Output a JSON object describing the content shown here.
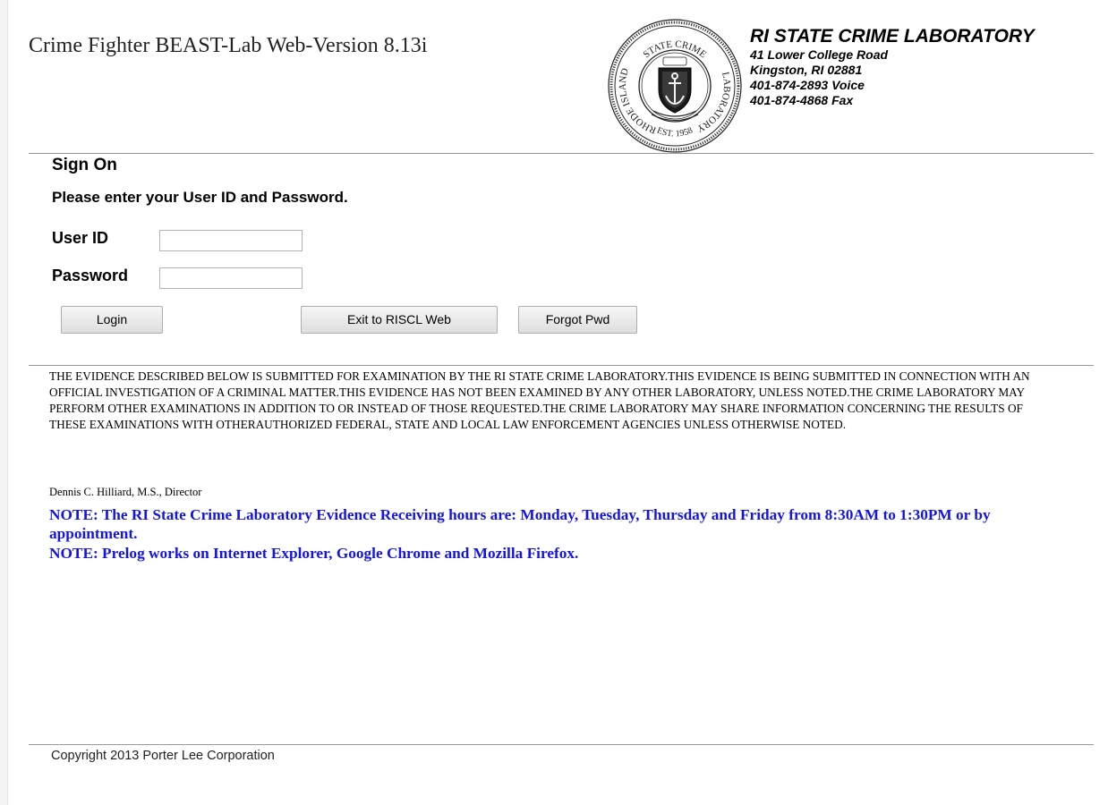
{
  "header": {
    "app_title": "Crime Fighter BEAST-Lab Web-Version 8.13i",
    "seal": {
      "ring_text_top": "STATE CRIME",
      "ring_text_left": "RHODE ISLAND",
      "ring_text_right": "LABORATORY",
      "ring_text_bottom": "EST. 1958"
    },
    "lab": {
      "name": "RI STATE CRIME LABORATORY",
      "address_line1": "41 Lower College Road",
      "address_line2": "Kingston, RI 02881",
      "voice": "401-874-2893 Voice",
      "fax": "401-874-4868 Fax"
    }
  },
  "sign_on": {
    "title": "Sign On",
    "instructions": "Please enter your User ID and Password.",
    "user_id_label": "User ID",
    "user_id_value": "",
    "password_label": "Password",
    "password_value": "",
    "buttons": {
      "login": "Login",
      "exit": "Exit to RISCL Web",
      "forgot": "Forgot Pwd"
    }
  },
  "disclaimer": {
    "text": "THE EVIDENCE DESCRIBED BELOW IS SUBMITTED FOR EXAMINATION BY THE RI STATE CRIME LABORATORY.THIS EVIDENCE IS BEING SUBMITTED IN CONNECTION WITH AN OFFICIAL INVESTIGATION OF A CRIMINAL MATTER.THIS EVIDENCE HAS NOT BEEN EXAMINED BY ANY OTHER LABORATORY, UNLESS NOTED.THE CRIME LABORATORY MAY PERFORM OTHER EXAMINATIONS IN ADDITION TO OR INSTEAD OF THOSE REQUESTED.THE CRIME LABORATORY MAY SHARE INFORMATION CONCERNING THE RESULTS OF THESE EXAMINATIONS WITH OTHERAUTHORIZED FEDERAL, STATE AND LOCAL LAW ENFORCEMENT AGENCIES UNLESS OTHERWISE NOTED.",
    "director": "Dennis C. Hilliard, M.S., Director"
  },
  "notes": {
    "hours": "NOTE: The RI State Crime Laboratory Evidence Receiving hours are: Monday, Tuesday, Thursday and Friday from 8:30AM to 1:30PM or by appointment.",
    "browsers": "NOTE: Prelog works on Internet Explorer, Google Chrome and Mozilla Firefox."
  },
  "footer": {
    "copyright": "Copyright 2013 Porter Lee Corporation"
  },
  "colors": {
    "note_blue": "#1414e6",
    "rule_gray": "#999999"
  }
}
